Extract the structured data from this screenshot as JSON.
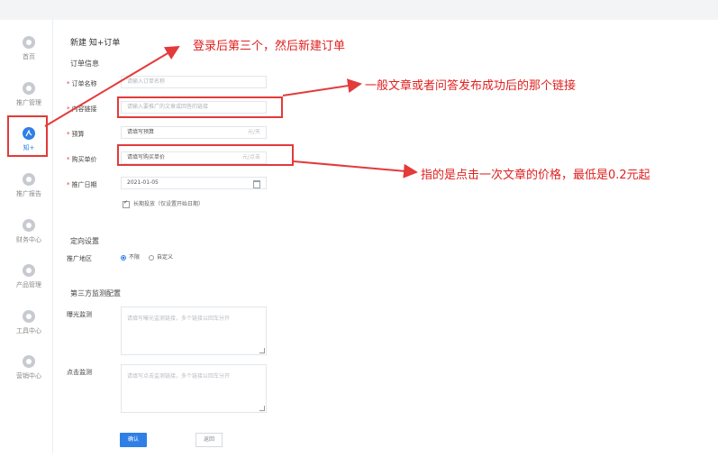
{
  "sidebar": {
    "items": [
      {
        "label": "首页",
        "icon": "home-icon"
      },
      {
        "label": "推广管理",
        "icon": "promotion-icon"
      },
      {
        "label": "知+",
        "icon": "zhiplus-icon",
        "active": true
      },
      {
        "label": "推广报告",
        "icon": "report-icon"
      },
      {
        "label": "财务中心",
        "icon": "finance-icon"
      },
      {
        "label": "产品管理",
        "icon": "product-icon"
      },
      {
        "label": "工具中心",
        "icon": "tools-icon"
      },
      {
        "label": "营销中心",
        "icon": "marketing-icon"
      }
    ]
  },
  "page": {
    "breadcrumb": "新建 知+订单",
    "section_order": "订单信息",
    "section_targeting": "定向设置",
    "section_monitor": "第三方监测配置"
  },
  "form": {
    "order_name": {
      "label": "订单名称",
      "placeholder": "请输入订单名称"
    },
    "content_link": {
      "label": "内容链接",
      "placeholder": "请输入要推广的文章或回答的链接"
    },
    "budget": {
      "label": "预算",
      "placeholder": "请填写预算",
      "suffix": "元/天"
    },
    "bid": {
      "label": "购买单价",
      "placeholder": "请填写购买单价",
      "suffix": "元/点击"
    },
    "date": {
      "label": "推广日期",
      "value": "2021-01-05"
    },
    "long_term": "长期投放（仅设置开始日期）",
    "region": {
      "label": "推广地区",
      "option_unlimited": "不限",
      "option_custom": "自定义"
    },
    "exposure_monitor": {
      "label": "曝光监测",
      "placeholder": "请填写曝光监测链接，多个链接以回车分开"
    },
    "click_monitor": {
      "label": "点击监测",
      "placeholder": "请填写点击监测链接，多个链接以回车分开"
    },
    "confirm_label": "确认",
    "back_label": "返回"
  },
  "annotations": {
    "step": "登录后第三个，然后新建订单",
    "link": "一般文章或者问答发布成功后的那个链接",
    "price": "指的是点击一次文章的价格，最低是0.2元起"
  },
  "colors": {
    "annotation": "#e33a3a",
    "primary": "#2f7fe6"
  }
}
